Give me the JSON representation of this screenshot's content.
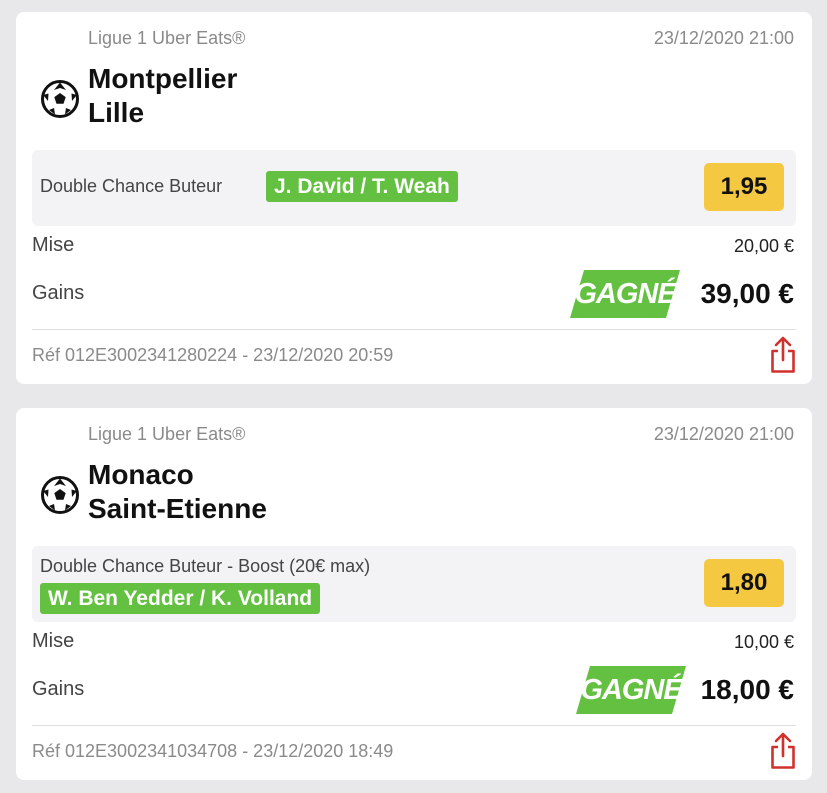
{
  "bets": [
    {
      "league": "Ligue 1 Uber Eats®",
      "date": "23/12/2020 21:00",
      "sport_icon": "soccer-ball-icon",
      "team_home": "Montpellier",
      "team_away": "Lille",
      "market": "Double Chance Buteur",
      "selection": "J. David / T. Weah",
      "odds": "1,95",
      "mise_label": "Mise",
      "mise_value": "20,00 €",
      "gains_label": "Gains",
      "status": "GAGNÉ",
      "gains_value": "39,00 €",
      "ref": "Réf 012E3002341280224 - 23/12/2020 20:59",
      "share_icon": "share-icon"
    },
    {
      "league": "Ligue 1 Uber Eats®",
      "date": "23/12/2020 21:00",
      "sport_icon": "soccer-ball-icon",
      "team_home": "Monaco",
      "team_away": "Saint-Etienne",
      "market": "Double Chance Buteur - Boost (20€ max)",
      "selection": "W. Ben Yedder / K. Volland",
      "odds": "1,80",
      "mise_label": "Mise",
      "mise_value": "10,00 €",
      "gains_label": "Gains",
      "status": "GAGNÉ",
      "gains_value": "18,00 €",
      "ref": "Réf 012E3002341034708 - 23/12/2020 18:49",
      "share_icon": "share-icon"
    }
  ],
  "colors": {
    "background": "#e8e8ea",
    "win_green": "#64c041",
    "odds_yellow": "#f5c842",
    "share_red": "#d0312d",
    "muted_text": "#8a8a8a"
  }
}
